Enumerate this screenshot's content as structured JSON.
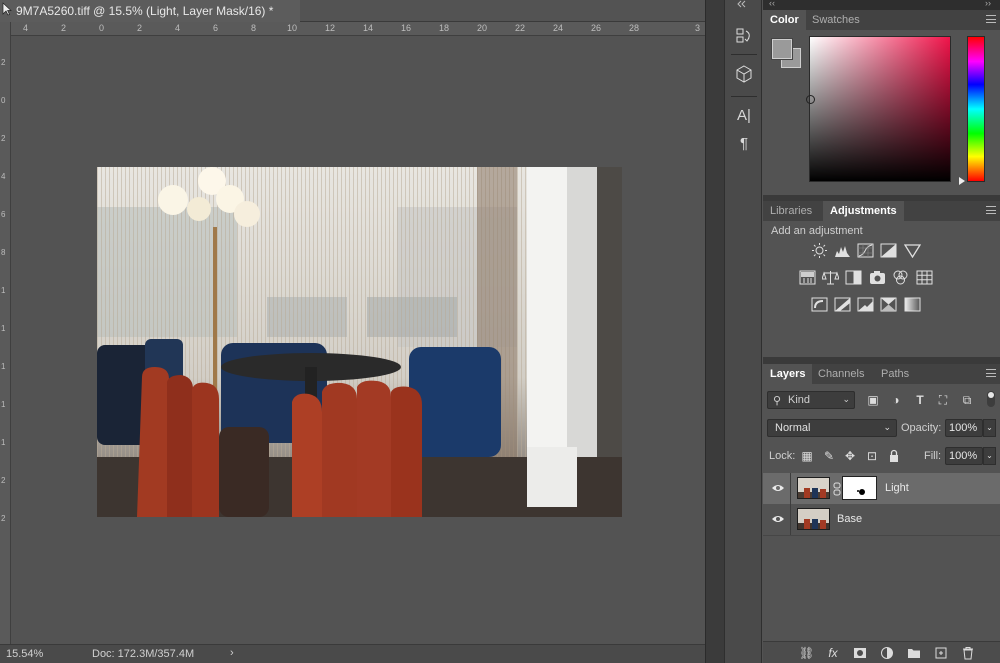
{
  "document": {
    "tab_title": "9M7A5260.tiff @ 15.5% (Light, Layer Mask/16) *",
    "ruler_top_ticks": [
      "4",
      "2",
      "0",
      "2",
      "4",
      "6",
      "8",
      "10",
      "12",
      "14",
      "16",
      "18",
      "20",
      "22",
      "24",
      "26",
      "28",
      "3"
    ],
    "ruler_left_ticks": [
      "2",
      "0",
      "2",
      "4",
      "6",
      "8",
      "1",
      "1",
      "1",
      "1",
      "1",
      "2",
      "2"
    ],
    "status_zoom": "15.54%",
    "status_doc": "Doc: 172.3M/357.4M",
    "status_arrow": "›"
  },
  "color_panel": {
    "tabs": [
      "Color",
      "Swatches"
    ],
    "active_tab": "Color",
    "foreground_color": "#9a9a9a",
    "background_color": "#9a9a9a",
    "hue_color": "#f0144a"
  },
  "adjustments_panel": {
    "tabs": [
      "Libraries",
      "Adjustments"
    ],
    "active_tab": "Adjustments",
    "subtitle": "Add an adjustment",
    "icons_row1": [
      "brightness-contrast-icon",
      "levels-icon",
      "curves-icon",
      "exposure-icon",
      "gradient-triangle-icon"
    ],
    "icons_row2": [
      "vibrance-icon",
      "balance-scale-icon",
      "black-white-icon",
      "photo-filter-icon",
      "channel-mixer-icon",
      "color-lookup-icon"
    ],
    "icons_row3": [
      "invert-icon",
      "posterize-icon",
      "threshold-icon",
      "selective-color-icon",
      "gradient-map-icon"
    ]
  },
  "layers_panel": {
    "tabs": [
      "Layers",
      "Channels",
      "Paths"
    ],
    "active_tab": "Layers",
    "filter_kind": "Kind",
    "blend_mode": "Normal",
    "opacity_label": "Opacity:",
    "opacity_value": "100%",
    "lock_label": "Lock:",
    "fill_label": "Fill:",
    "fill_value": "100%",
    "layers": [
      {
        "name": "Light",
        "selected": true,
        "has_mask": true
      },
      {
        "name": "Base",
        "selected": false,
        "has_mask": false
      }
    ]
  }
}
